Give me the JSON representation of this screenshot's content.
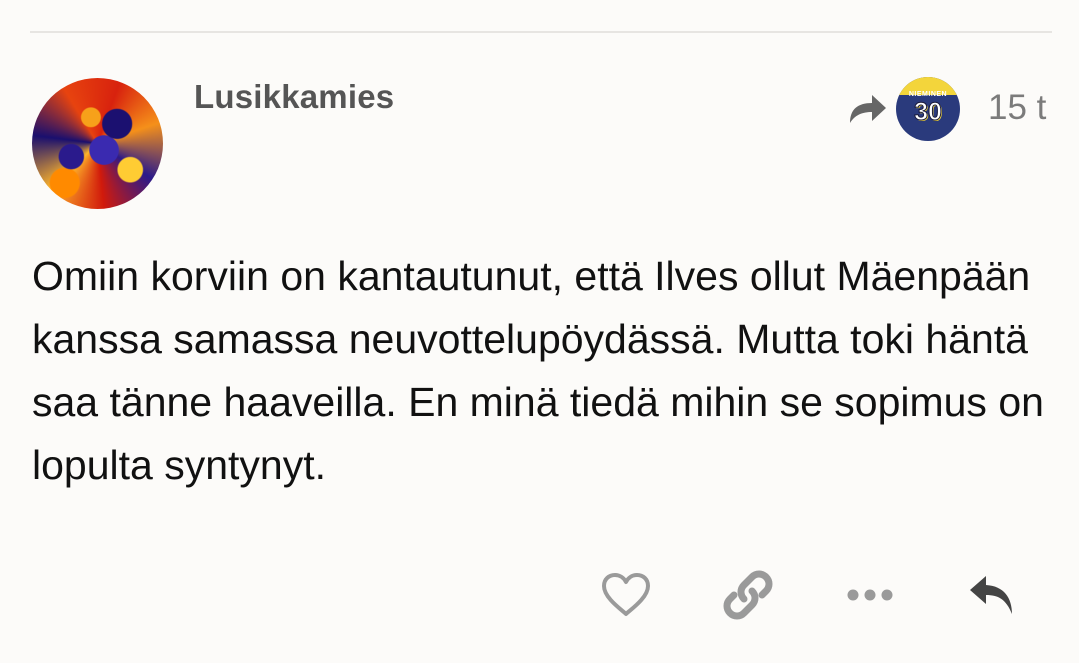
{
  "post": {
    "username": "Lusikkamies",
    "timestamp": "15 t",
    "body": "Omiin korviin on kantautunut, että Ilves ollut Mäenpään kanssa samassa neuvottelupöydässä. Mutta toki häntä saa tänne haaveilla. En minä tiedä mihin se sopimus on lopulta syntynyt.",
    "reply_to": {
      "avatar_text": "NIEMINEN",
      "avatar_number": "30",
      "icon": "reply-to-arrow-icon"
    }
  },
  "actions": [
    {
      "name": "like-button",
      "icon": "heart-icon"
    },
    {
      "name": "copy-link-button",
      "icon": "link-icon"
    },
    {
      "name": "more-button",
      "icon": "ellipsis-icon"
    },
    {
      "name": "reply-button",
      "icon": "reply-icon"
    }
  ],
  "colors": {
    "background": "#fcfbf9",
    "username": "#555555",
    "muted": "#7b7b7b",
    "icon": "#9a9a9a",
    "reply_icon": "#444444",
    "text": "#111111"
  }
}
